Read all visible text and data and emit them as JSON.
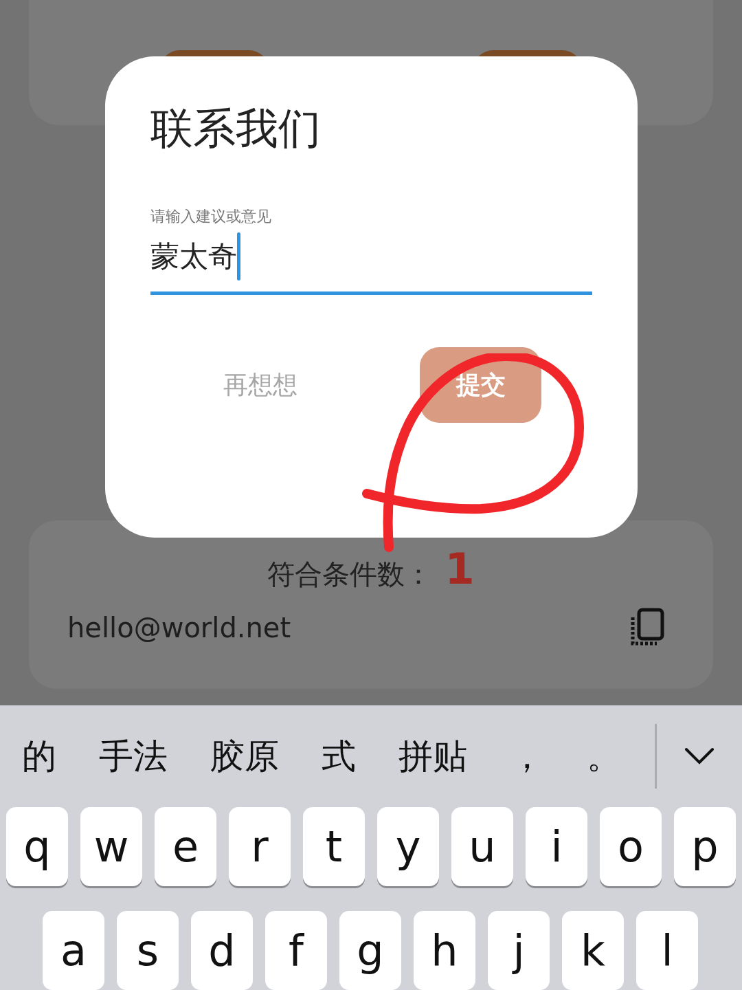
{
  "dialog": {
    "title": "联系我们",
    "field": {
      "label": "请输入建议或意见",
      "value": "蒙太奇",
      "focused": true
    },
    "buttons": [
      {
        "label": "再想想",
        "kind": "text"
      },
      {
        "label": "提交",
        "kind": "filled"
      }
    ]
  },
  "result_card": {
    "label": "符合条件数：",
    "count": "1",
    "email": "hello@world.net"
  },
  "keyboard": {
    "candidates": [
      "的",
      "手法",
      "胶原",
      "式",
      "拼贴",
      "，",
      "。"
    ],
    "rows": [
      [
        "q",
        "w",
        "e",
        "r",
        "t",
        "y",
        "u",
        "i",
        "o",
        "p"
      ],
      [
        "a",
        "s",
        "d",
        "f",
        "g",
        "h",
        "j",
        "k",
        "l"
      ]
    ]
  }
}
